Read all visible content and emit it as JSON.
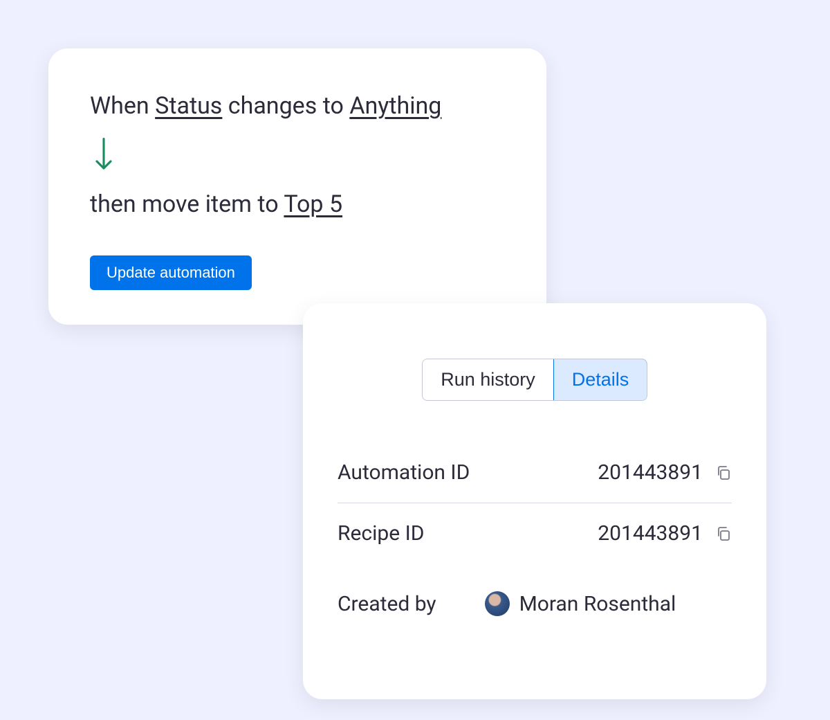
{
  "automation": {
    "trigger_prefix": "When ",
    "trigger_field": "Status",
    "trigger_mid": " changes to ",
    "trigger_value": "Anything",
    "action_prefix": "then move item to ",
    "action_target": "Top 5",
    "update_button": "Update automation"
  },
  "details": {
    "tabs": {
      "run_history": "Run history",
      "details": "Details"
    },
    "automation_id": {
      "label": "Automation ID",
      "value": "201443891"
    },
    "recipe_id": {
      "label": "Recipe ID",
      "value": "201443891"
    },
    "created_by": {
      "label": "Created by",
      "name": "Moran Rosenthal"
    }
  }
}
